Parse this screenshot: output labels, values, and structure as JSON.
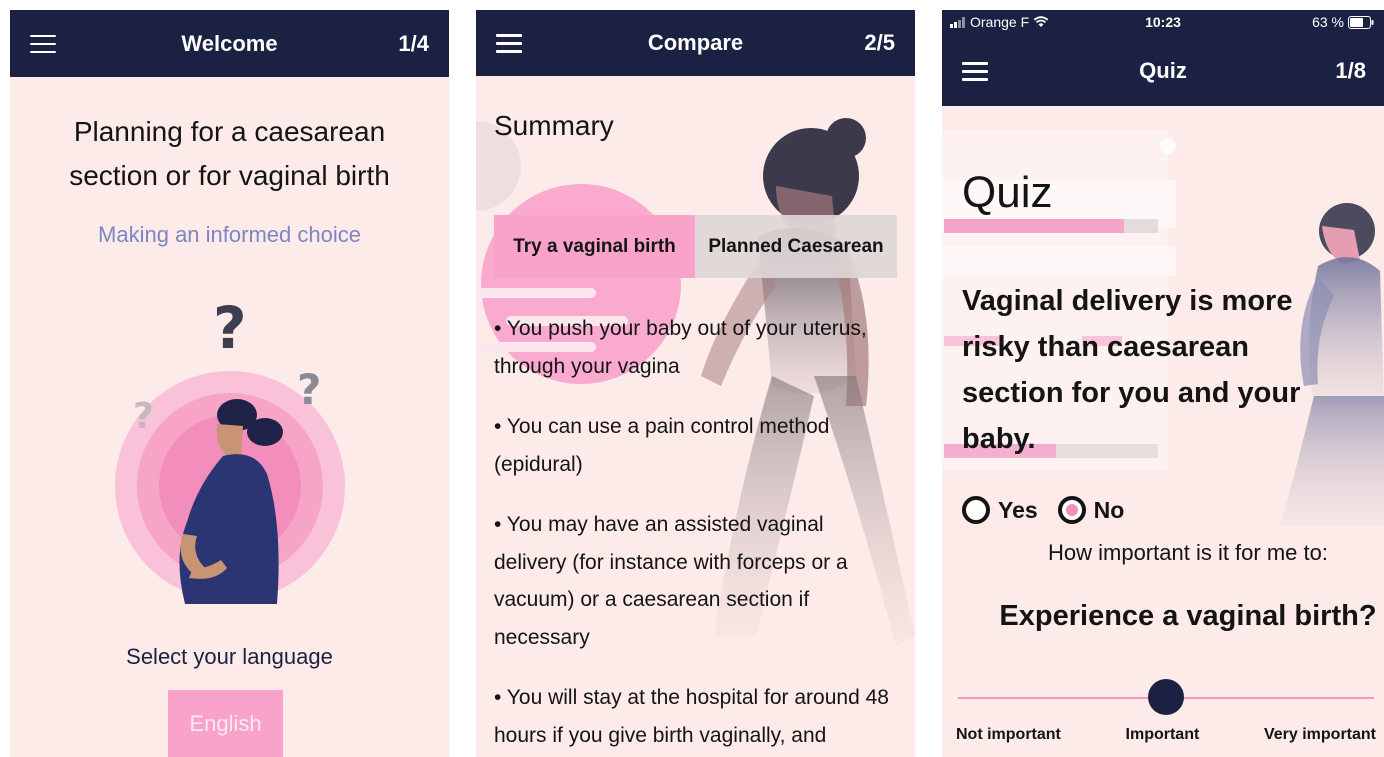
{
  "screens": [
    {
      "appbar": {
        "title": "Welcome",
        "counter": "1/4"
      },
      "headline_line1": "Planning for a caesarean",
      "headline_line2": "section or for vaginal birth",
      "subtitle": "Making an informed choice",
      "language_label": "Select your language",
      "language_button": "English"
    },
    {
      "appbar": {
        "title": "Compare",
        "counter": "2/5"
      },
      "section_title": "Summary",
      "tabs": [
        {
          "label": "Try a vaginal birth",
          "active": true
        },
        {
          "label": "Planned Caesarean",
          "active": false
        }
      ],
      "bullets": [
        "• You push your baby out of your uterus, through your vagina",
        "• You can use a pain control method (epidural)",
        "• You may have an assisted vaginal delivery (for instance with forceps or a vacuum) or a caesarean section if necessary",
        "• You will stay at the hospital for around 48 hours if you give birth vaginally, and"
      ]
    },
    {
      "status_bar": {
        "carrier": "Orange F",
        "time": "10:23",
        "battery": "63 %"
      },
      "appbar": {
        "title": "Quiz",
        "counter": "1/8"
      },
      "quiz_title": "Quiz",
      "question": "Vaginal delivery is more risky than caesarean section for you and your baby.",
      "options": [
        {
          "label": "Yes",
          "selected": false
        },
        {
          "label": "No",
          "selected": true
        }
      ],
      "importance_prompt": "How important is it for me to:",
      "importance_question": "Experience a vaginal birth?",
      "slider": {
        "labels": [
          "Not important",
          "Important",
          "Very important"
        ],
        "value_label": "Important"
      }
    }
  ],
  "colors": {
    "appbar": "#1a2142",
    "background": "#fcebe9",
    "accent_pink": "#f9a3cb",
    "subtitle_blue": "#7d86c4"
  }
}
